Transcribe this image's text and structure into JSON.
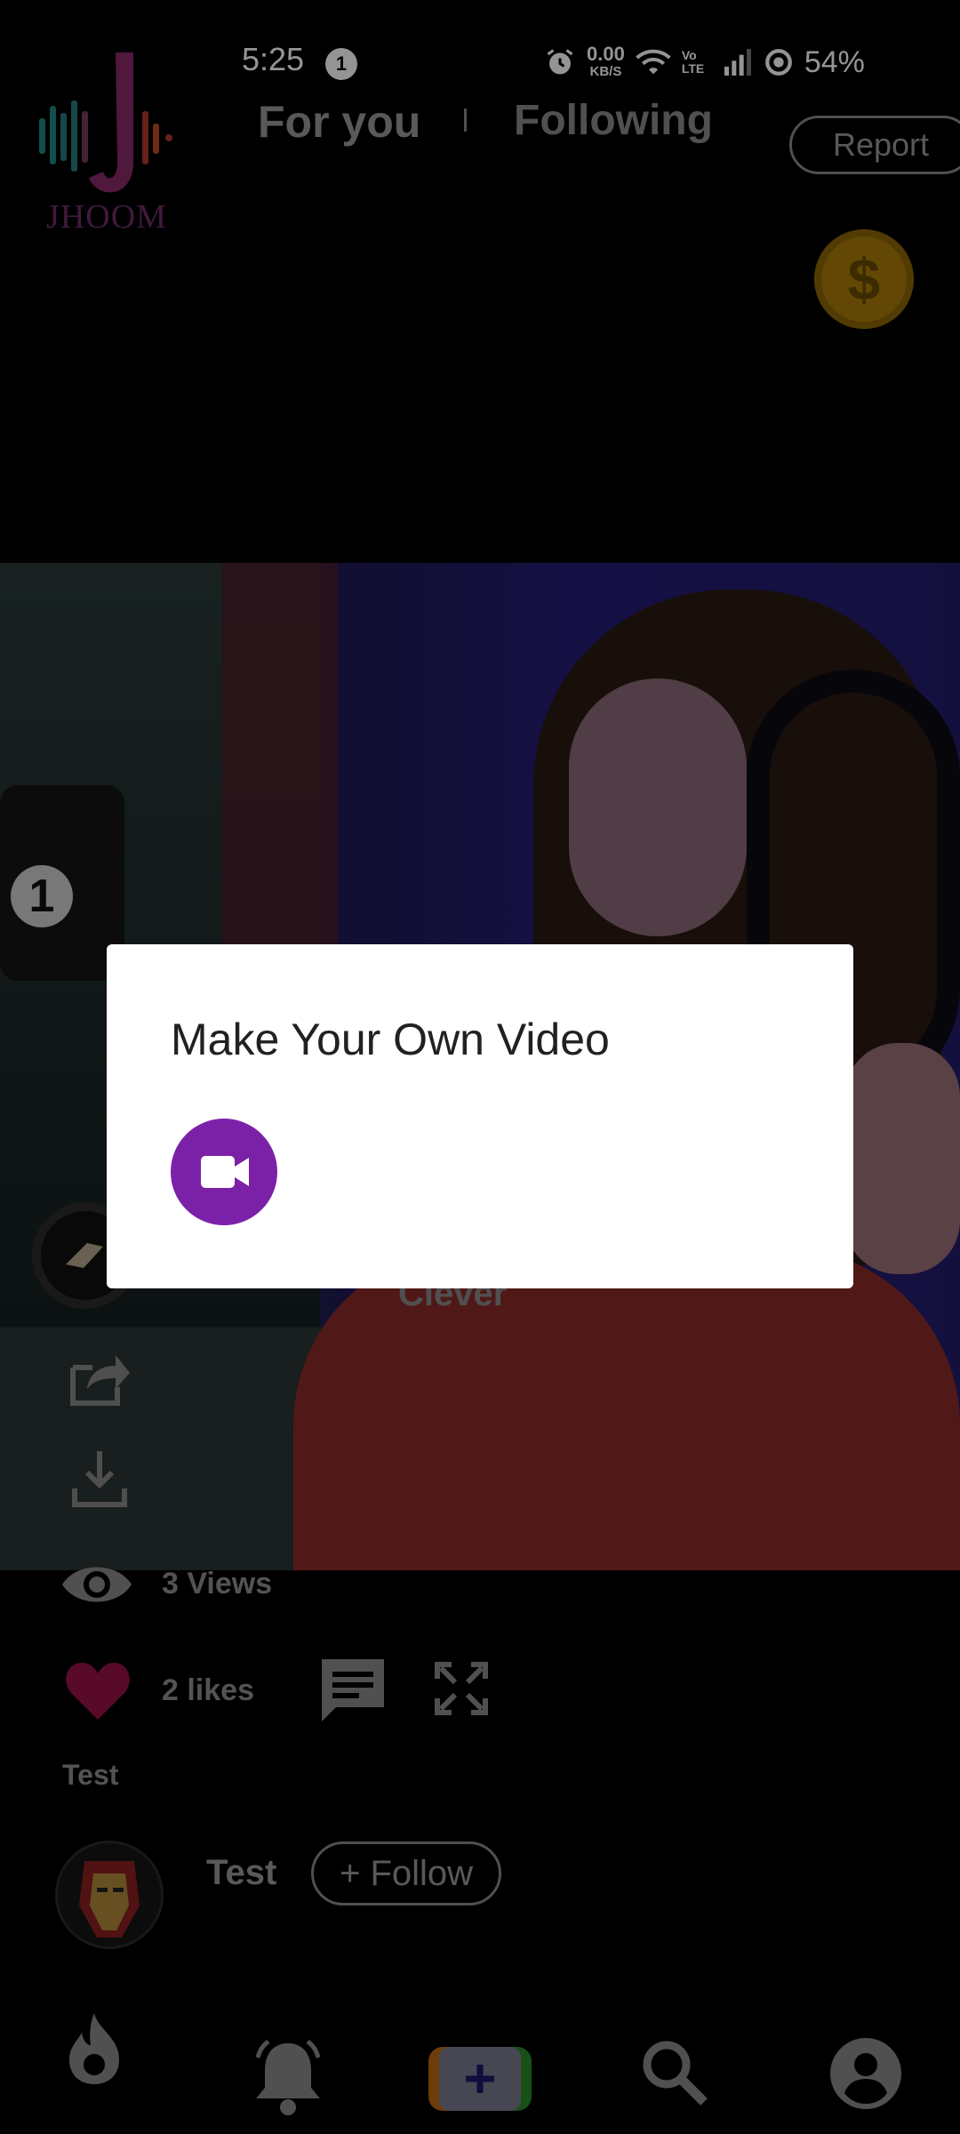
{
  "status_bar": {
    "time": "5:25",
    "notification_count": "1",
    "network_speed_value": "0.00",
    "network_speed_unit": "KB/S",
    "volte": "Vo LTE",
    "battery": "54%"
  },
  "header": {
    "logo_text": "JHOOM",
    "tabs": [
      {
        "label": "For you"
      },
      {
        "label": "Following"
      }
    ],
    "report_label": "Report"
  },
  "video": {
    "caption_overlay": "Clever",
    "studio_number": "1"
  },
  "stats": {
    "views": "3 Views",
    "likes": "2 likes"
  },
  "post": {
    "title": "Test",
    "author": "Test",
    "follow_label": "+ Follow"
  },
  "dialog": {
    "title": "Make Your Own Video",
    "action_icon": "video-camera-icon"
  },
  "bottom_nav": {
    "items": [
      "flame-icon",
      "bell-icon",
      "plus-icon",
      "search-icon",
      "profile-icon"
    ]
  },
  "colors": {
    "dialog_accent": "#7b21a8",
    "heart": "#c2185b",
    "background": "#000000"
  }
}
